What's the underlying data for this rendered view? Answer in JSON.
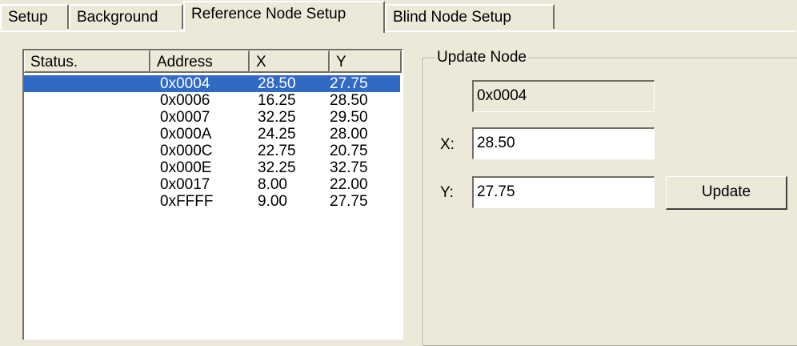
{
  "tabs": [
    {
      "label": "Setup"
    },
    {
      "label": "Background"
    },
    {
      "label": "Reference Node Setup"
    },
    {
      "label": "Blind Node Setup"
    }
  ],
  "list": {
    "columns": [
      "Status.",
      "Address",
      "X",
      "Y"
    ],
    "rows": [
      {
        "status": "",
        "address": "0x0004",
        "x": "28.50",
        "y": "27.75",
        "selected": true
      },
      {
        "status": "",
        "address": "0x0006",
        "x": "16.25",
        "y": "28.50"
      },
      {
        "status": "",
        "address": "0x0007",
        "x": "32.25",
        "y": "29.50"
      },
      {
        "status": "",
        "address": "0x000A",
        "x": "24.25",
        "y": "28.00"
      },
      {
        "status": "",
        "address": "0x000C",
        "x": "22.75",
        "y": "20.75"
      },
      {
        "status": "",
        "address": "0x000E",
        "x": "32.25",
        "y": "32.75"
      },
      {
        "status": "",
        "address": "0x0017",
        "x": "8.00",
        "y": "22.00"
      },
      {
        "status": "",
        "address": "0xFFFF",
        "x": "9.00",
        "y": "27.75"
      }
    ]
  },
  "update_node": {
    "title": "Update Node",
    "address_value": "0x0004",
    "x_label": "X:",
    "x_value": "28.50",
    "y_label": "Y:",
    "y_value": "27.75",
    "update_label": "Update"
  },
  "colors": {
    "window_bg": "#ece9d8",
    "selection": "#316ac5"
  }
}
